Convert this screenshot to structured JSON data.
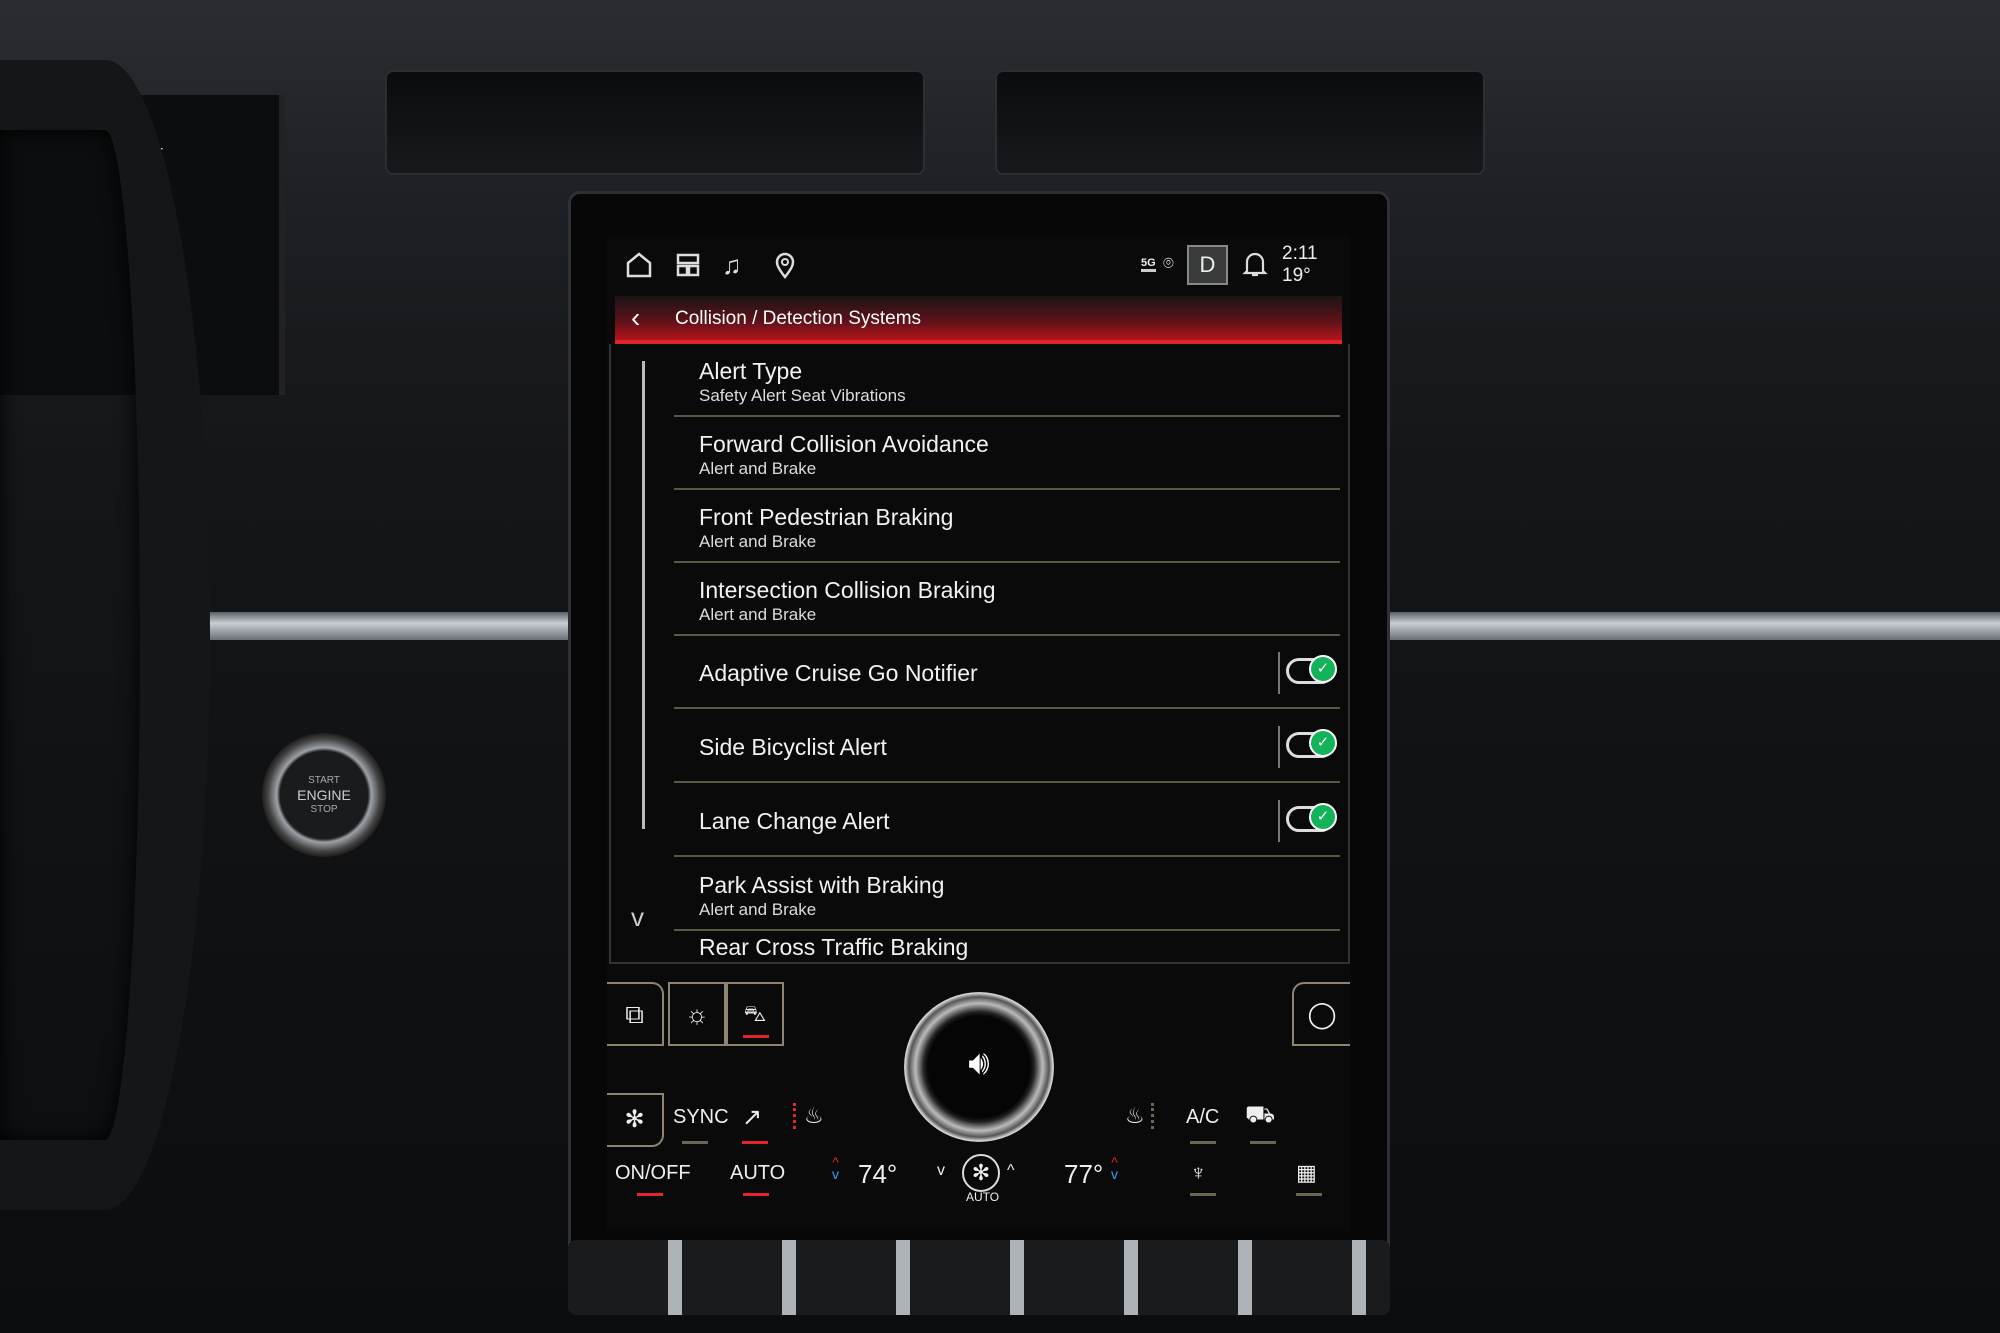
{
  "cluster": {
    "temp": "19°F"
  },
  "start_button": {
    "line1": "START",
    "line2": "ENGINE",
    "line3": "STOP"
  },
  "status_bar": {
    "icons": [
      "home-icon",
      "apps-grid-icon",
      "music-icon",
      "location-pin-icon"
    ],
    "network": "5G",
    "drive_mode": "D",
    "time": "2:11",
    "temperature": "19°"
  },
  "header": {
    "back_icon": "chevron-left-icon",
    "title": "Collision / Detection Systems"
  },
  "list": {
    "items": [
      {
        "title": "Alert Type",
        "subtitle": "Safety Alert Seat Vibrations"
      },
      {
        "title": "Forward Collision Avoidance",
        "subtitle": "Alert and Brake"
      },
      {
        "title": "Front Pedestrian Braking",
        "subtitle": "Alert and Brake"
      },
      {
        "title": "Intersection Collision Braking",
        "subtitle": "Alert and Brake"
      },
      {
        "title": "Adaptive Cruise Go Notifier",
        "toggle": true
      },
      {
        "title": "Side Bicyclist Alert",
        "toggle": true
      },
      {
        "title": "Lane Change Alert",
        "toggle": true
      },
      {
        "title": "Park Assist with Braking",
        "subtitle": "Alert and Brake"
      },
      {
        "title": "Rear Cross Traffic Braking"
      }
    ]
  },
  "quick_controls": {
    "icons": [
      "toggle-switches-icon",
      "brightness-icon",
      "lane-assist-car-icon",
      "circle-icon"
    ],
    "volume_icon": "speaker-volume-icon"
  },
  "climate": {
    "row1": {
      "sync": "SYNC",
      "ac": "A/C"
    },
    "row2": {
      "onoff": "ON/OFF",
      "auto": "AUTO",
      "driver_temp": "74°",
      "fan_auto": "AUTO",
      "passenger_temp": "77°"
    }
  },
  "colors": {
    "accent_red": "#e0262b",
    "toggle_on": "#13b35a",
    "temp_up": "#e0262b",
    "temp_down": "#3aa0e8"
  }
}
